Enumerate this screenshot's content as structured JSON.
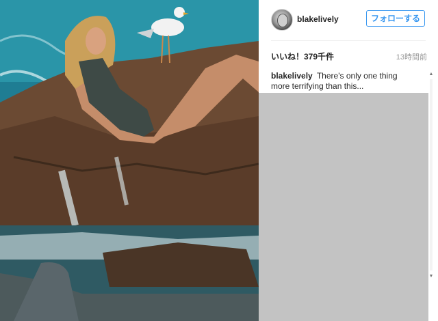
{
  "post": {
    "username": "blakelively",
    "follow_label": "フォローする",
    "likes_text": "いいね！379千件",
    "timestamp": "13時間前",
    "caption_text": "There's only one thing more terrifying than this..."
  },
  "photo": {
    "alt_subject": "woman lounging on rocks by the sea with a seagull and a shark fin",
    "icon": "photo-image"
  },
  "colors": {
    "follow_blue": "#3897f0",
    "text_dark": "#262626",
    "text_muted": "#999999",
    "comments_gray": "#c3c3c3"
  }
}
